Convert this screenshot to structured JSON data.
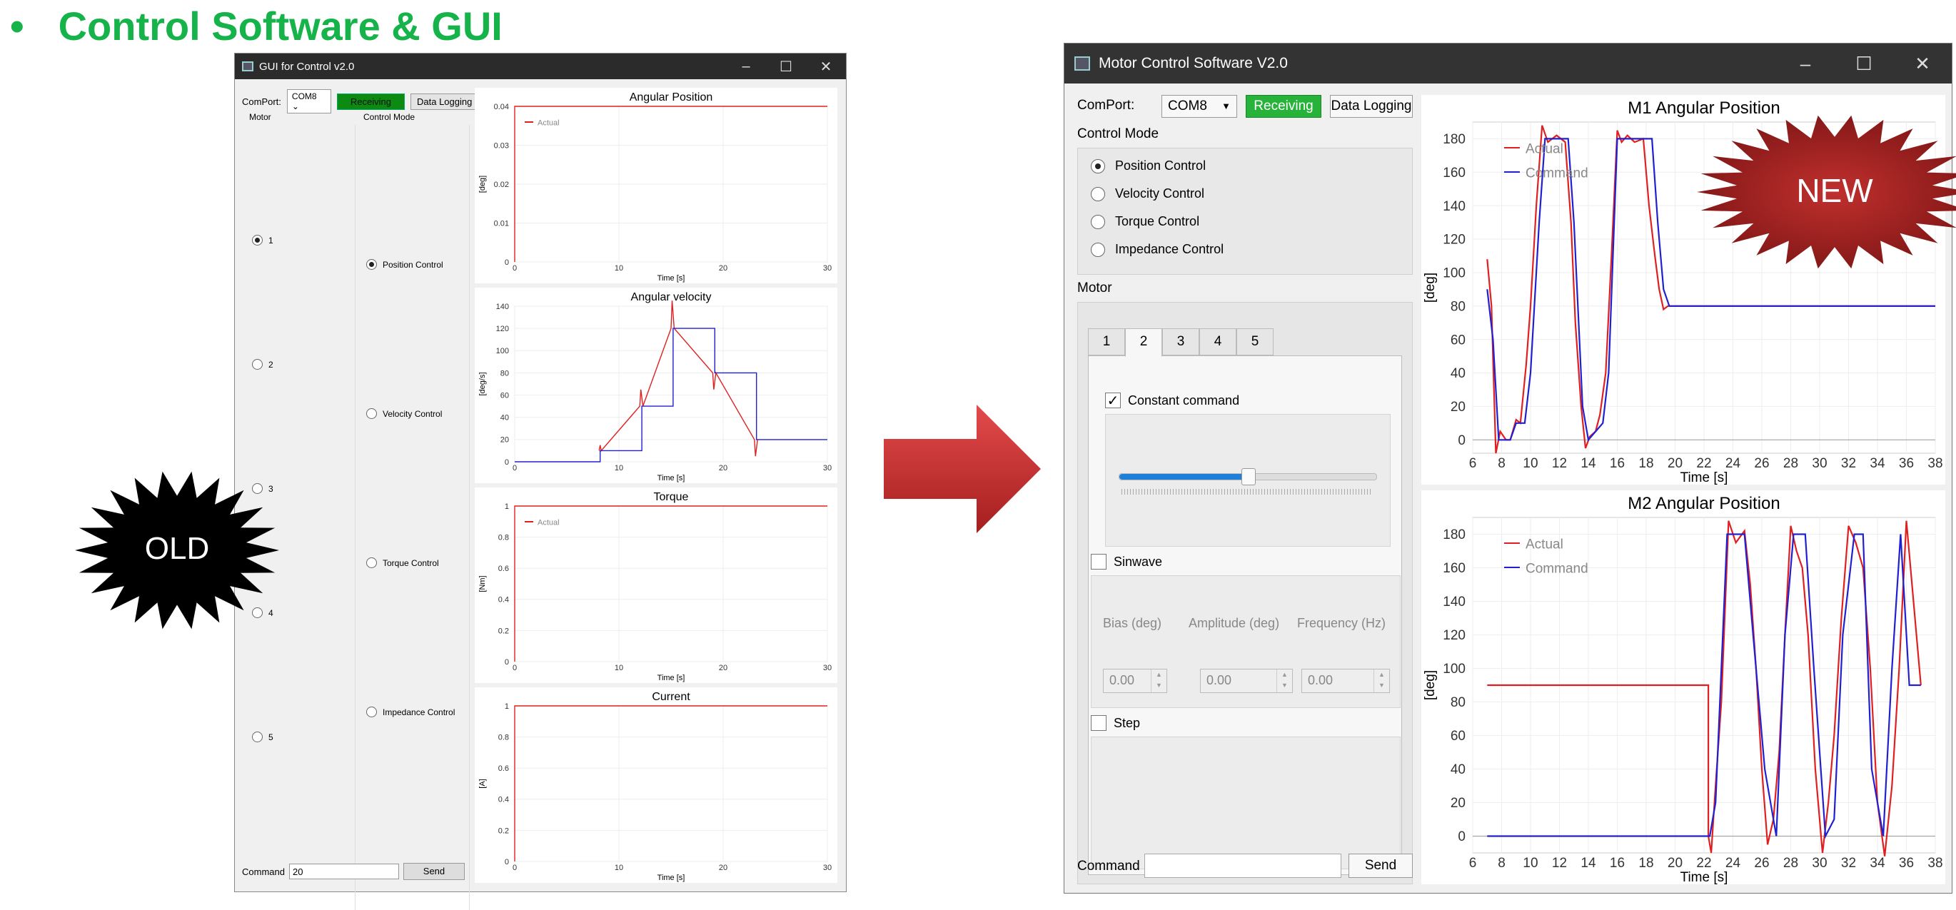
{
  "slide": {
    "bullet": "•",
    "title": "Control Software & GUI"
  },
  "badges": {
    "old": "OLD",
    "new": "NEW"
  },
  "old_gui": {
    "window_title": "GUI for Control v2.0",
    "window_controls": {
      "minimize": "–",
      "maximize": "☐",
      "close": "✕"
    },
    "comport_label": "ComPort:",
    "comport_value": "COM8",
    "receiving_label": "Receiving",
    "data_logging_label": "Data Logging",
    "motor_header": "Motor",
    "control_mode_header": "Control Mode",
    "motors": [
      "1",
      "2",
      "3",
      "4",
      "5"
    ],
    "selected_motor": "1",
    "modes": [
      "Position Control",
      "Velocity Control",
      "Torque Control",
      "Impedance Control"
    ],
    "selected_mode": "Position Control",
    "command_label": "Command",
    "command_value": "20",
    "send_label": "Send"
  },
  "new_gui": {
    "window_title": "Motor Control Software V2.0",
    "window_controls": {
      "minimize": "–",
      "maximize": "☐",
      "close": "✕"
    },
    "comport_label": "ComPort:",
    "comport_value": "COM8",
    "receiving_label": "Receiving",
    "data_logging_label": "Data Logging",
    "control_mode_label": "Control Mode",
    "modes": [
      "Position Control",
      "Velocity Control",
      "Torque Control",
      "Impedance Control"
    ],
    "selected_mode": "Position Control",
    "motor_label": "Motor",
    "motor_tabs": [
      "1",
      "2",
      "3",
      "4",
      "5"
    ],
    "active_tab": "2",
    "constant_command": {
      "label": "Constant command",
      "checked": true,
      "check_mark": "✓",
      "slider_value": 0.5
    },
    "sinwave": {
      "label": "Sinwave",
      "checked": false,
      "bias_label": "Bias (deg)",
      "amplitude_label": "Amplitude (deg)",
      "frequency_label": "Frequency (Hz)",
      "bias_value": "0.00",
      "amplitude_value": "0.00",
      "frequency_value": "0.00"
    },
    "step": {
      "label": "Step",
      "checked": false
    },
    "command_label": "Command",
    "command_value": "",
    "send_label": "Send"
  },
  "chart_data": [
    {
      "id": "old-angular-position",
      "type": "line",
      "title": "Angular Position",
      "xlabel": "Time [s]",
      "ylabel": "[deg]",
      "xlim": [
        0,
        30
      ],
      "ylim": [
        0,
        0.04
      ],
      "xticks": [
        0,
        10,
        20,
        30
      ],
      "yticks": [
        0,
        0.01,
        0.02,
        0.03,
        0.04
      ],
      "legend": [
        "Actual"
      ],
      "grid": true,
      "series": [
        {
          "name": "Actual",
          "color": "#e02020",
          "x": [
            0,
            0,
            30
          ],
          "y": [
            0,
            0.04,
            0.04
          ]
        }
      ]
    },
    {
      "id": "old-angular-velocity",
      "type": "line",
      "title": "Angular velocity",
      "xlabel": "Time [s]",
      "ylabel": "[deg/s]",
      "xlim": [
        0,
        30
      ],
      "ylim": [
        0,
        140
      ],
      "xticks": [
        0,
        10,
        20,
        30
      ],
      "yticks": [
        0,
        20,
        40,
        60,
        80,
        100,
        120,
        140
      ],
      "legend": [],
      "grid": true,
      "series": [
        {
          "name": "",
          "color": "#e02020",
          "x": [
            8.1,
            8.2,
            8.3,
            12,
            12.1,
            12.3,
            15,
            15.1,
            15.3,
            19,
            19.1,
            19.3,
            23,
            23.1,
            23.3
          ],
          "y": [
            10,
            15,
            10,
            50,
            65,
            50,
            120,
            145,
            120,
            80,
            65,
            80,
            20,
            5,
            20
          ]
        },
        {
          "name": "",
          "color": "#2020d0",
          "x": [
            0,
            8.2,
            8.2,
            12.2,
            12.2,
            15.2,
            15.2,
            19.2,
            19.2,
            23.2,
            23.2,
            30
          ],
          "y": [
            0,
            0,
            10,
            10,
            50,
            50,
            120,
            120,
            80,
            80,
            20,
            20
          ]
        }
      ]
    },
    {
      "id": "old-torque",
      "type": "line",
      "title": "Torque",
      "xlabel": "Time [s]",
      "ylabel": "[Nm]",
      "xlim": [
        0,
        30
      ],
      "ylim": [
        0,
        1
      ],
      "xticks": [
        0,
        10,
        20,
        30
      ],
      "yticks": [
        0,
        0.2,
        0.4,
        0.6,
        0.8,
        1
      ],
      "legend": [
        "Actual"
      ],
      "grid": true,
      "series": [
        {
          "name": "Actual",
          "color": "#e02020",
          "x": [
            0,
            0,
            30
          ],
          "y": [
            0,
            1,
            1
          ]
        }
      ]
    },
    {
      "id": "old-current",
      "type": "line",
      "title": "Current",
      "xlabel": "Time [s]",
      "ylabel": "[A]",
      "xlim": [
        0,
        30
      ],
      "ylim": [
        0,
        1
      ],
      "xticks": [
        0,
        10,
        20,
        30
      ],
      "yticks": [
        0,
        0.2,
        0.4,
        0.6,
        0.8,
        1
      ],
      "legend": [],
      "grid": true,
      "series": [
        {
          "name": "",
          "color": "#e02020",
          "x": [
            0,
            0,
            30
          ],
          "y": [
            0,
            1,
            1
          ]
        }
      ]
    },
    {
      "id": "new-m1-position",
      "type": "line",
      "title": "M1 Angular Position",
      "xlabel": "Time [s]",
      "ylabel": "[deg]",
      "xlim": [
        6,
        38
      ],
      "ylim": [
        -8,
        190
      ],
      "xticks": [
        6,
        8,
        10,
        12,
        14,
        16,
        18,
        20,
        22,
        24,
        26,
        28,
        30,
        32,
        34,
        36,
        38
      ],
      "yticks": [
        0,
        20,
        40,
        60,
        80,
        100,
        120,
        140,
        160,
        180
      ],
      "legend": [
        "Actual",
        "Command"
      ],
      "grid": true,
      "series": [
        {
          "name": "Actual",
          "color": "#e02020",
          "x": [
            7,
            7.3,
            7.6,
            7.9,
            8.3,
            8.6,
            9.0,
            9.3,
            9.7,
            10.0,
            10.4,
            10.8,
            11.2,
            11.8,
            12.4,
            12.8,
            13.1,
            13.5,
            13.8,
            14.1,
            14.5,
            14.8,
            15.2,
            15.6,
            16.0,
            16.3,
            16.7,
            17.2,
            17.8,
            18.2,
            18.6,
            18.9,
            19.2,
            19.5,
            38
          ],
          "y": [
            108,
            80,
            -8,
            5,
            0,
            0,
            12,
            10,
            45,
            80,
            140,
            188,
            178,
            182,
            178,
            130,
            70,
            20,
            -5,
            2,
            5,
            15,
            40,
            110,
            185,
            178,
            182,
            178,
            180,
            140,
            110,
            90,
            78,
            80,
            80
          ]
        },
        {
          "name": "Command",
          "color": "#2020d0",
          "x": [
            7,
            7.4,
            7.8,
            8.6,
            9.0,
            9.6,
            10.0,
            10.6,
            11.0,
            12.6,
            13.0,
            13.6,
            14.0,
            15.0,
            15.4,
            16.0,
            18.4,
            18.8,
            19.2,
            19.6,
            38
          ],
          "y": [
            90,
            60,
            0,
            0,
            10,
            10,
            40,
            130,
            180,
            180,
            130,
            20,
            0,
            10,
            40,
            180,
            180,
            130,
            90,
            80,
            80
          ]
        }
      ]
    },
    {
      "id": "new-m2-position",
      "type": "line",
      "title": "M2 Angular Position",
      "xlabel": "Time [s]",
      "ylabel": "[deg]",
      "xlim": [
        6,
        38
      ],
      "ylim": [
        -10,
        190
      ],
      "xticks": [
        6,
        8,
        10,
        12,
        14,
        16,
        18,
        20,
        22,
        24,
        26,
        28,
        30,
        32,
        34,
        36,
        38
      ],
      "yticks": [
        0,
        20,
        40,
        60,
        80,
        100,
        120,
        140,
        160,
        180
      ],
      "legend": [
        "Actual",
        "Command"
      ],
      "grid": true,
      "series": [
        {
          "name": "Actual",
          "color": "#e02020",
          "x": [
            7,
            22.3,
            22.3,
            22.5,
            22.8,
            23.2,
            23.7,
            24.2,
            24.8,
            25.2,
            25.6,
            26.0,
            26.4,
            26.8,
            27.2,
            27.6,
            28.0,
            28.4,
            28.8,
            29.2,
            29.7,
            30.2,
            30.6,
            31.0,
            31.5,
            32.0,
            32.5,
            33.0,
            33.5,
            34.0,
            34.5,
            35.0,
            35.5,
            36.0,
            37
          ],
          "y": [
            90,
            90,
            0,
            -10,
            30,
            80,
            188,
            175,
            182,
            150,
            100,
            40,
            -5,
            10,
            50,
            120,
            185,
            170,
            160,
            120,
            40,
            -10,
            20,
            60,
            130,
            185,
            175,
            160,
            100,
            20,
            -12,
            30,
            100,
            188,
            90
          ]
        },
        {
          "name": "Command",
          "color": "#2020d0",
          "x": [
            7,
            22.4,
            22.8,
            23.6,
            24.8,
            25.4,
            26.2,
            27.0,
            27.6,
            28.2,
            29.0,
            29.6,
            30.4,
            31.0,
            31.6,
            32.4,
            33.0,
            33.6,
            34.4,
            35.0,
            35.6,
            36.2,
            37
          ],
          "y": [
            0,
            0,
            20,
            180,
            180,
            120,
            40,
            0,
            120,
            180,
            180,
            100,
            0,
            10,
            120,
            180,
            180,
            40,
            0,
            100,
            180,
            90,
            90
          ]
        }
      ]
    }
  ]
}
